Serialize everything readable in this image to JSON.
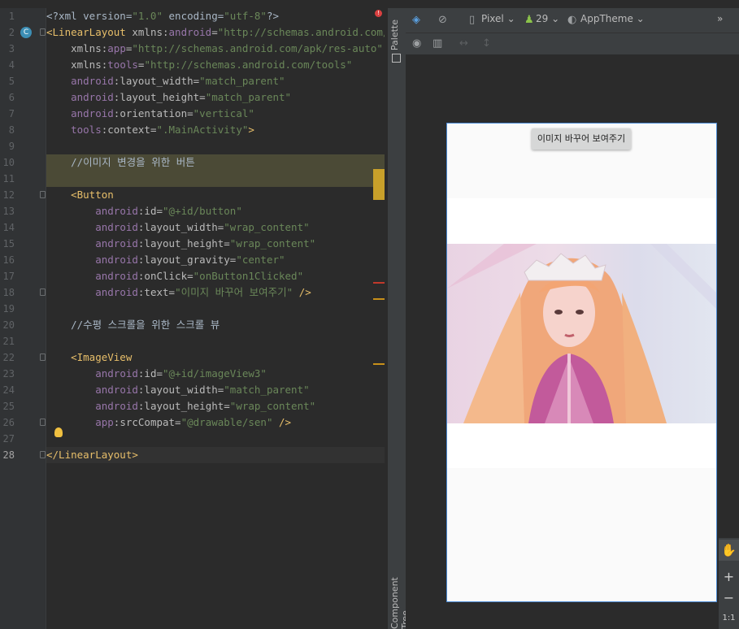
{
  "editor": {
    "line_numbers": [
      "1",
      "2",
      "3",
      "4",
      "5",
      "6",
      "7",
      "8",
      "9",
      "10",
      "11",
      "12",
      "13",
      "14",
      "15",
      "16",
      "17",
      "18",
      "19",
      "20",
      "21",
      "22",
      "23",
      "24",
      "25",
      "26",
      "27",
      "28"
    ],
    "lines": [
      [
        {
          "t": "<?xml version=",
          "c": "c-txt"
        },
        {
          "t": "\"1.0\"",
          "c": "c-str"
        },
        {
          "t": " encoding=",
          "c": "c-txt"
        },
        {
          "t": "\"utf-8\"",
          "c": "c-str"
        },
        {
          "t": "?>",
          "c": "c-txt"
        }
      ],
      [
        {
          "t": "<LinearLayout",
          "c": "c-tag"
        },
        {
          "t": " xmlns:",
          "c": "c-attr"
        },
        {
          "t": "android",
          "c": "c-ns"
        },
        {
          "t": "=",
          "c": "c-attr"
        },
        {
          "t": "\"http://schemas.android.com/apk",
          "c": "c-str"
        }
      ],
      [
        {
          "t": "    xmlns:",
          "c": "c-attr"
        },
        {
          "t": "app",
          "c": "c-ns"
        },
        {
          "t": "=",
          "c": "c-attr"
        },
        {
          "t": "\"http://schemas.android.com/apk/res-auto\"",
          "c": "c-str"
        }
      ],
      [
        {
          "t": "    xmlns:",
          "c": "c-attr"
        },
        {
          "t": "tools",
          "c": "c-ns"
        },
        {
          "t": "=",
          "c": "c-attr"
        },
        {
          "t": "\"http://schemas.android.com/tools\"",
          "c": "c-str"
        }
      ],
      [
        {
          "t": "    ",
          "c": "c-attr"
        },
        {
          "t": "android",
          "c": "c-ns"
        },
        {
          "t": ":layout_width=",
          "c": "c-attr"
        },
        {
          "t": "\"match_parent\"",
          "c": "c-str"
        }
      ],
      [
        {
          "t": "    ",
          "c": "c-attr"
        },
        {
          "t": "android",
          "c": "c-ns"
        },
        {
          "t": ":layout_height=",
          "c": "c-attr"
        },
        {
          "t": "\"match_parent\"",
          "c": "c-str"
        }
      ],
      [
        {
          "t": "    ",
          "c": "c-attr"
        },
        {
          "t": "android",
          "c": "c-ns"
        },
        {
          "t": ":orientation=",
          "c": "c-attr"
        },
        {
          "t": "\"vertical\"",
          "c": "c-str"
        }
      ],
      [
        {
          "t": "    ",
          "c": "c-attr"
        },
        {
          "t": "tools",
          "c": "c-ns"
        },
        {
          "t": ":context=",
          "c": "c-attr"
        },
        {
          "t": "\".MainActivity\"",
          "c": "c-str"
        },
        {
          "t": ">",
          "c": "c-tag"
        }
      ],
      [],
      [
        {
          "t": "    //이미지 변경을 위한 버튼",
          "c": "c-txt"
        }
      ],
      [],
      [
        {
          "t": "    <Button",
          "c": "c-tag"
        }
      ],
      [
        {
          "t": "        ",
          "c": "c-attr"
        },
        {
          "t": "android",
          "c": "c-ns"
        },
        {
          "t": ":id=",
          "c": "c-attr"
        },
        {
          "t": "\"@+id/button\"",
          "c": "c-str"
        }
      ],
      [
        {
          "t": "        ",
          "c": "c-attr"
        },
        {
          "t": "android",
          "c": "c-ns"
        },
        {
          "t": ":layout_width=",
          "c": "c-attr"
        },
        {
          "t": "\"wrap_content\"",
          "c": "c-str"
        }
      ],
      [
        {
          "t": "        ",
          "c": "c-attr"
        },
        {
          "t": "android",
          "c": "c-ns"
        },
        {
          "t": ":layout_height=",
          "c": "c-attr"
        },
        {
          "t": "\"wrap_content\"",
          "c": "c-str"
        }
      ],
      [
        {
          "t": "        ",
          "c": "c-attr"
        },
        {
          "t": "android",
          "c": "c-ns"
        },
        {
          "t": ":layout_gravity=",
          "c": "c-attr"
        },
        {
          "t": "\"center\"",
          "c": "c-str"
        }
      ],
      [
        {
          "t": "        ",
          "c": "c-attr"
        },
        {
          "t": "android",
          "c": "c-ns"
        },
        {
          "t": ":onClick=",
          "c": "c-attr"
        },
        {
          "t": "\"onButton1Clicked\"",
          "c": "c-str"
        }
      ],
      [
        {
          "t": "        ",
          "c": "c-attr"
        },
        {
          "t": "android",
          "c": "c-ns"
        },
        {
          "t": ":text=",
          "c": "c-attr"
        },
        {
          "t": "\"이미지 바꾸어 보여주기\"",
          "c": "c-str"
        },
        {
          "t": " />",
          "c": "c-tag"
        }
      ],
      [],
      [
        {
          "t": "    //수평 스크롤을 위한 스크롤 뷰",
          "c": "c-txt"
        }
      ],
      [],
      [
        {
          "t": "    <ImageView",
          "c": "c-tag"
        }
      ],
      [
        {
          "t": "        ",
          "c": "c-attr"
        },
        {
          "t": "android",
          "c": "c-ns"
        },
        {
          "t": ":id=",
          "c": "c-attr"
        },
        {
          "t": "\"@+id/imageView3\"",
          "c": "c-str"
        }
      ],
      [
        {
          "t": "        ",
          "c": "c-attr"
        },
        {
          "t": "android",
          "c": "c-ns"
        },
        {
          "t": ":layout_width=",
          "c": "c-attr"
        },
        {
          "t": "\"match_parent\"",
          "c": "c-str"
        }
      ],
      [
        {
          "t": "        ",
          "c": "c-attr"
        },
        {
          "t": "android",
          "c": "c-ns"
        },
        {
          "t": ":layout_height=",
          "c": "c-attr"
        },
        {
          "t": "\"wrap_content\"",
          "c": "c-str"
        }
      ],
      [
        {
          "t": "        ",
          "c": "c-attr"
        },
        {
          "t": "app",
          "c": "c-ns"
        },
        {
          "t": ":srcCompat=",
          "c": "c-attr"
        },
        {
          "t": "\"@drawable/sen\"",
          "c": "c-str"
        },
        {
          "t": " />",
          "c": "c-tag"
        }
      ],
      [],
      [
        {
          "t": "</LinearLayout>",
          "c": "c-tag"
        }
      ]
    ]
  },
  "side_tabs": {
    "palette": "Palette",
    "component_tree": "Component Tree"
  },
  "design_toolbar": {
    "device": "Pixel",
    "api_level": "29",
    "theme": "AppTheme",
    "more": "»"
  },
  "preview": {
    "button_text": "이미지 바꾸어 보여주기"
  },
  "zoom": {
    "zoom_in": "+",
    "zoom_out": "−",
    "ratio": "1:1"
  },
  "colors": {
    "tag": "#e8bf6a",
    "namespace": "#9876aa",
    "string": "#6a8759",
    "accent": "#4b8ad4"
  }
}
